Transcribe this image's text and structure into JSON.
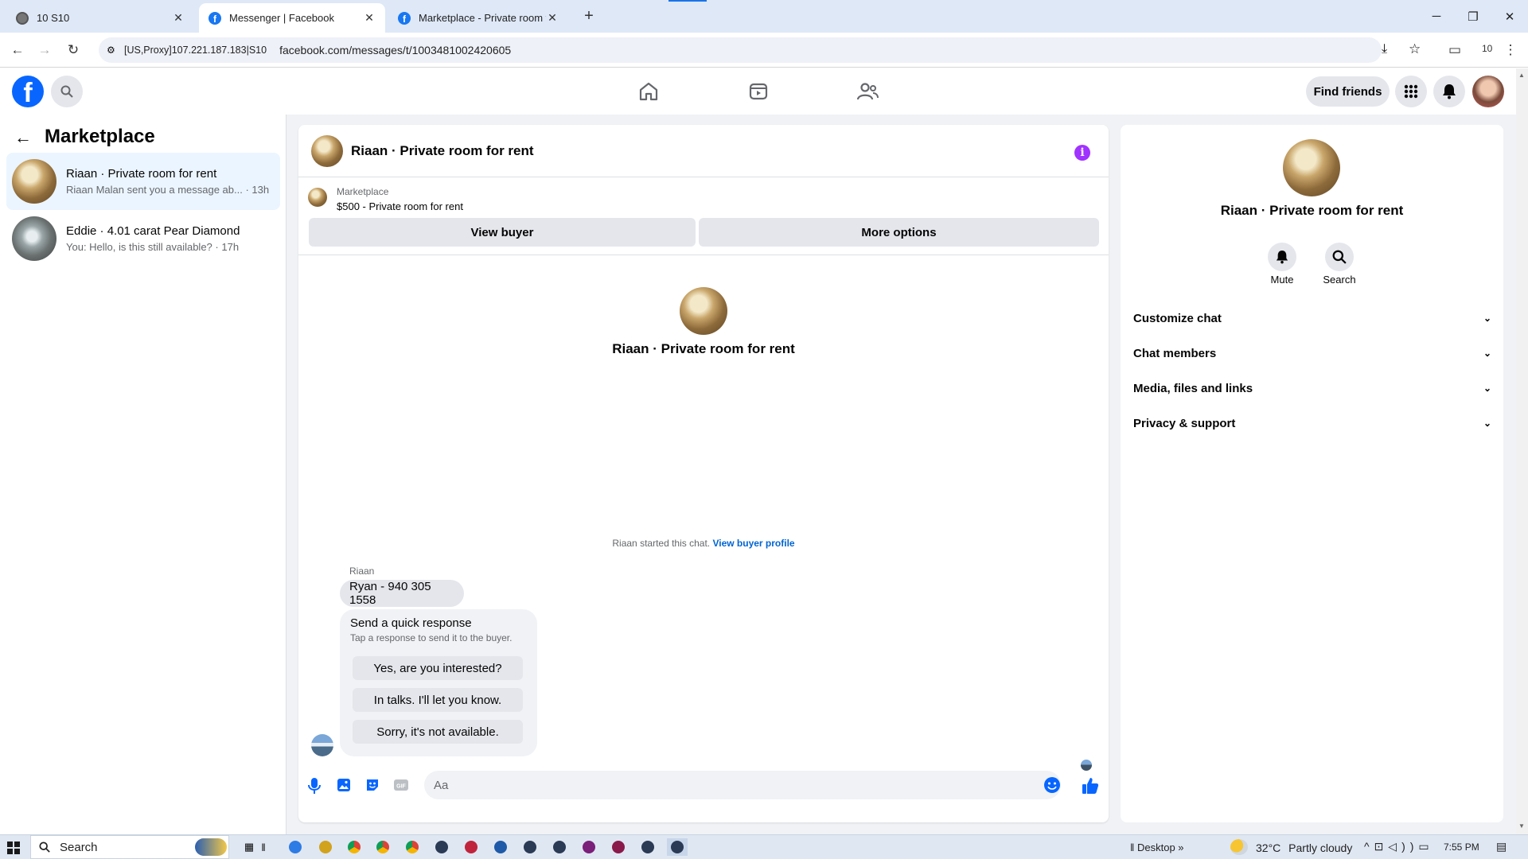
{
  "browser": {
    "tabs": [
      {
        "title": "10 S10",
        "active": false
      },
      {
        "title": "Messenger | Facebook",
        "active": true
      },
      {
        "title": "Marketplace - Private room for",
        "active": false
      }
    ],
    "new_tab": "+",
    "site_info": "[US,Proxy]107.221.187.183|S10",
    "url": "facebook.com/messages/t/1003481002420605",
    "profile_count": "10"
  },
  "fb_header": {
    "find_friends": "Find friends"
  },
  "left": {
    "title": "Marketplace",
    "chats": [
      {
        "title": "Riaan · Private room for rent",
        "preview": "Riaan Malan sent you a message ab...",
        "time": "· 13h",
        "selected": true
      },
      {
        "title": "Eddie · 4.01 carat Pear Diamond",
        "preview": "You: Hello, is this still available?",
        "time": "· 17h",
        "selected": false
      }
    ]
  },
  "chat": {
    "title": "Riaan · Private room for rent",
    "listing_source": "Marketplace",
    "listing": "$500 - Private room for rent",
    "view_buyer": "View buyer",
    "more_options": "More options",
    "intro_name": "Riaan · Private room for rent",
    "started_text": "Riaan started this chat.",
    "view_buyer_profile": "View buyer profile",
    "sender": "Riaan",
    "message": "Ryan - 940 305 1558",
    "quick_title": "Send a quick response",
    "quick_sub": "Tap a response to send it to the buyer.",
    "quick_replies": [
      "Yes, are you interested?",
      "In talks. I'll let you know.",
      "Sorry, it's not available."
    ],
    "input_placeholder": "Aa"
  },
  "info": {
    "name": "Riaan · Private room for rent",
    "mute": "Mute",
    "search": "Search",
    "sections": [
      "Customize chat",
      "Chat members",
      "Media, files and links",
      "Privacy & support"
    ]
  },
  "taskbar": {
    "search": "Search",
    "desktop": "Desktop",
    "temp": "32°C",
    "weather": "Partly cloudy",
    "time": "7:55 PM"
  },
  "colors": {
    "fb_blue": "#1877f2",
    "selected_bg": "#ebf5ff",
    "info_purple": "#a033ff"
  }
}
